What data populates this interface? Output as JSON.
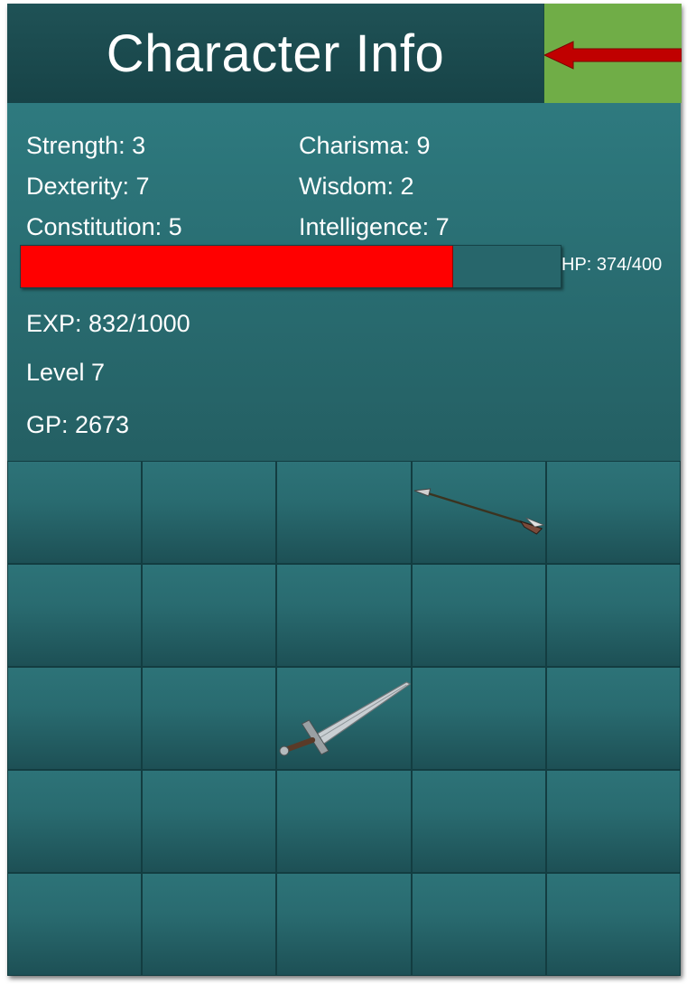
{
  "header": {
    "title": "Character Info",
    "back_icon": "arrow-left-icon"
  },
  "colors": {
    "header_bg": "#1d4f53",
    "panel_bg": "#2a6f74",
    "back_bg": "#70ad47",
    "arrow": "#c00000",
    "hp_fill": "#ff0000"
  },
  "stats": {
    "strength": "Strength: 3",
    "dexterity": "Dexterity: 7",
    "constitution": "Constitution: 5",
    "charisma": "Charisma: 9",
    "wisdom": "Wisdom: 2",
    "intelligence": "Intelligence: 7"
  },
  "hp": {
    "text": "HP: 374/400",
    "current": 374,
    "max": 400
  },
  "exp": "EXP: 832/1000",
  "level": "Level 7",
  "gp": "GP: 2673",
  "inventory": {
    "rows": 5,
    "cols": 5,
    "items": [
      {
        "row": 0,
        "col": 3,
        "icon": "arrow-item-icon"
      },
      {
        "row": 2,
        "col": 2,
        "icon": "sword-item-icon"
      }
    ]
  }
}
